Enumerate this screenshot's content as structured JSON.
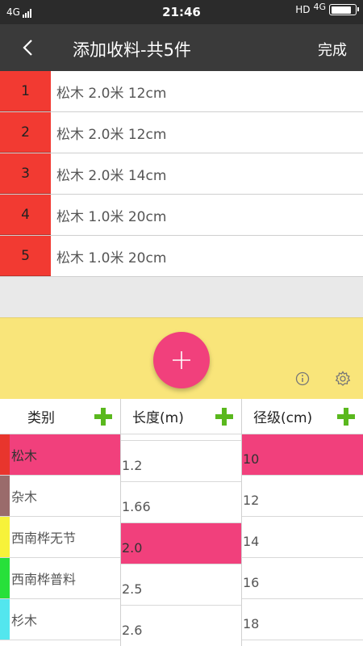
{
  "status": {
    "network": "4G",
    "time": "21:46",
    "hd": "HD",
    "network_right": "4G",
    "battery_level": 0.85
  },
  "header": {
    "back_icon": "chevron-left-icon",
    "title": "添加收料-共5件",
    "done_label": "完成"
  },
  "items": [
    {
      "index": "1",
      "text": "松木 2.0米  12cm"
    },
    {
      "index": "2",
      "text": "松木 2.0米  12cm"
    },
    {
      "index": "3",
      "text": "松木 2.0米  14cm"
    },
    {
      "index": "4",
      "text": "松木 1.0米  20cm"
    },
    {
      "index": "5",
      "text": "松木 1.0米  20cm"
    }
  ],
  "actions": {
    "add_icon": "plus-icon",
    "info_icon": "info-icon",
    "settings_icon": "gear-icon"
  },
  "columns": {
    "category": {
      "header": "类别",
      "items": [
        {
          "label": "松木",
          "color": "#e8352d",
          "selected": true
        },
        {
          "label": "杂木",
          "color": "#9a6b6b",
          "selected": false
        },
        {
          "label": "西南桦无节",
          "color": "#f7f23a",
          "selected": false
        },
        {
          "label": "西南桦普料",
          "color": "#27e03a",
          "selected": false
        },
        {
          "label": "杉木",
          "color": "#53e6ee",
          "selected": false
        }
      ]
    },
    "length": {
      "header": "长度(m)",
      "items": [
        {
          "label": "1.2",
          "selected": false
        },
        {
          "label": "1.66",
          "selected": false
        },
        {
          "label": "2.0",
          "selected": true
        },
        {
          "label": "2.5",
          "selected": false
        },
        {
          "label": "2.6",
          "selected": false
        }
      ]
    },
    "diameter": {
      "header": "径级(cm)",
      "items": [
        {
          "label": "10",
          "selected": true
        },
        {
          "label": "12",
          "selected": false
        },
        {
          "label": "14",
          "selected": false
        },
        {
          "label": "16",
          "selected": false
        },
        {
          "label": "18",
          "selected": false
        }
      ]
    }
  },
  "colors": {
    "index_red": "#f23a32",
    "accent_pink": "#f1407c",
    "panel_yellow": "#f9e57a",
    "plus_green": "#5ab81e",
    "titlebar": "#3a3a3a"
  }
}
